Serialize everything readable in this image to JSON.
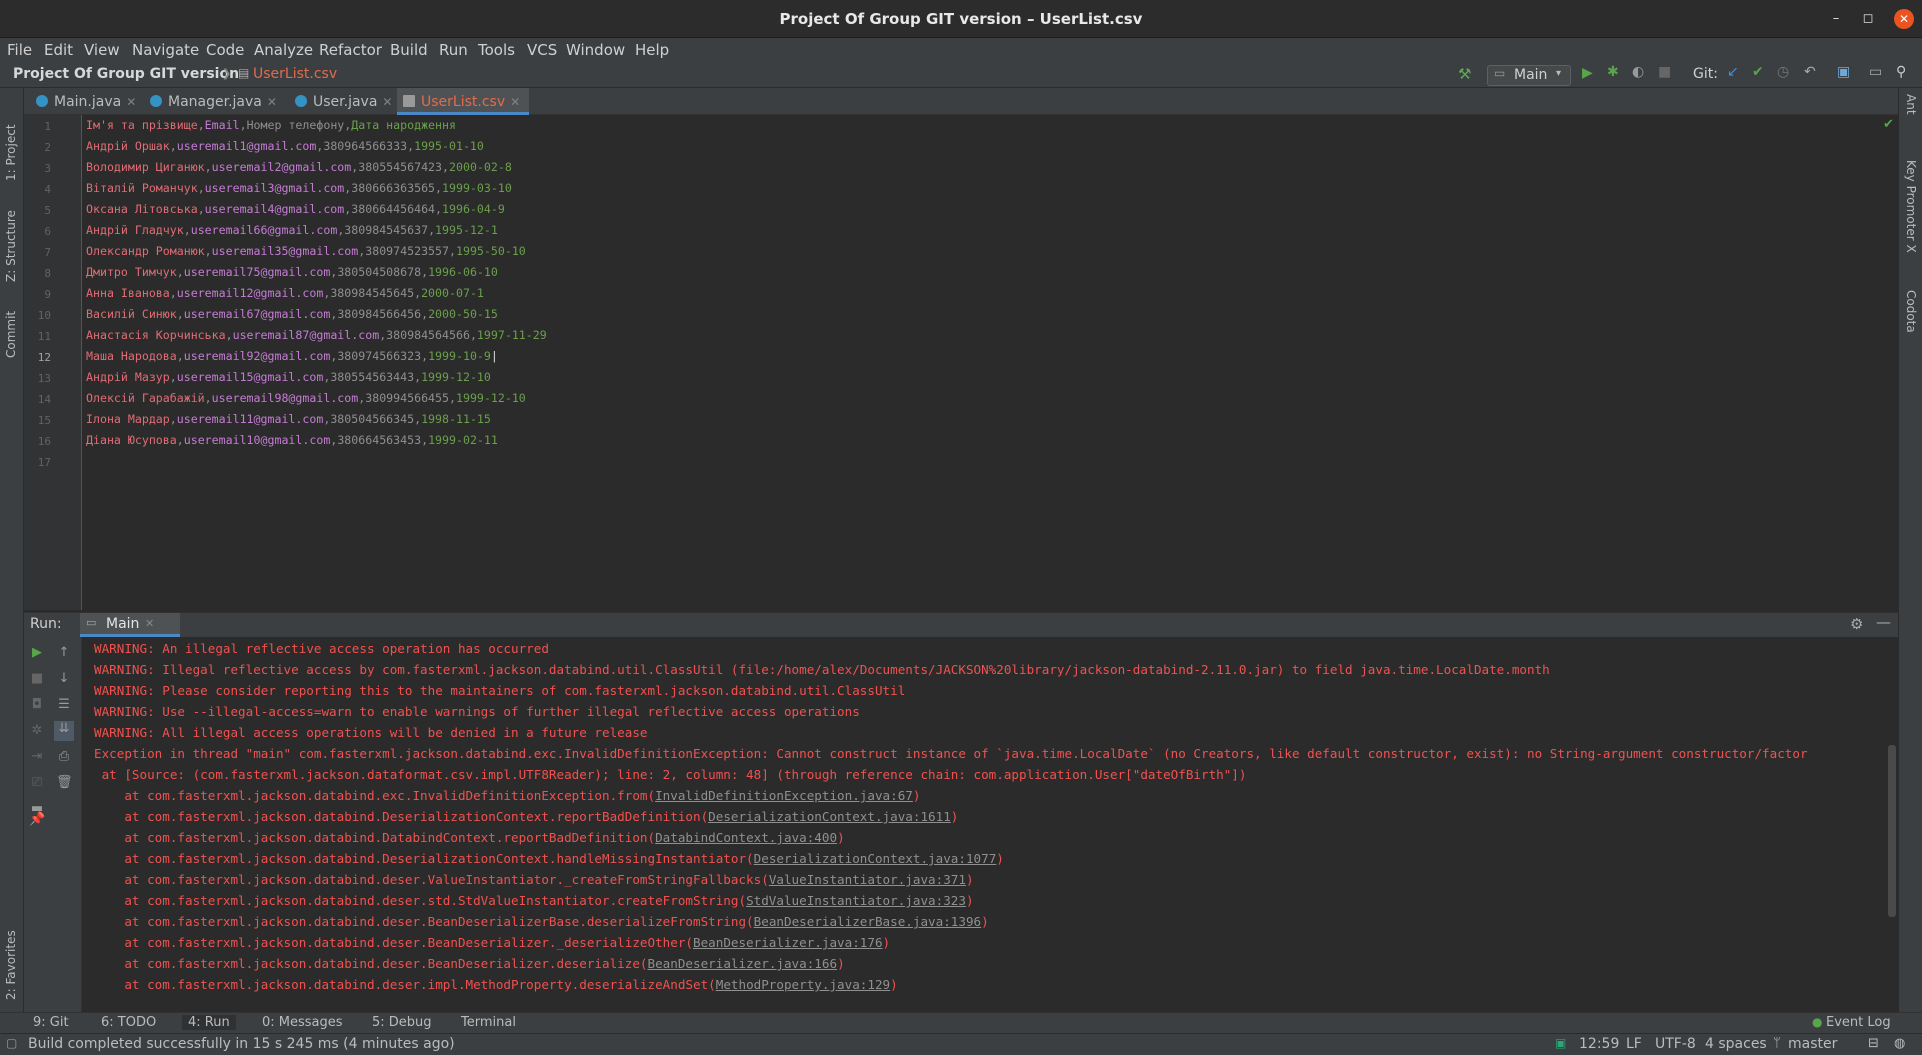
{
  "window": {
    "title": "Project Of Group GIT version – UserList.csv",
    "minimize": "–",
    "maximize": "◻",
    "close": "✕"
  },
  "menu": [
    "File",
    "Edit",
    "View",
    "Navigate",
    "Code",
    "Analyze",
    "Refactor",
    "Build",
    "Run",
    "Tools",
    "VCS",
    "Window",
    "Help"
  ],
  "navbar": {
    "project": "Project Of Group GIT version",
    "file": "UserList.csv",
    "run_config": "Main",
    "git_label": "Git:"
  },
  "left_stripe": [
    "1: Project",
    "Z: Structure",
    "Commit",
    "2: Favorites"
  ],
  "right_stripe": [
    "Ant",
    "Key Promoter X",
    "Codota"
  ],
  "tabs": [
    {
      "label": "Main.java",
      "active": false
    },
    {
      "label": "Manager.java",
      "active": false
    },
    {
      "label": "User.java",
      "active": false
    },
    {
      "label": "UserList.csv",
      "active": true
    }
  ],
  "editor": {
    "line_numbers": [
      "1",
      "2",
      "3",
      "4",
      "5",
      "6",
      "7",
      "8",
      "9",
      "10",
      "11",
      "12",
      "13",
      "14",
      "15",
      "16",
      "17"
    ],
    "lines": [
      [
        "Ім'я та прізвище",
        "Email",
        "Номер телефону",
        "Дата народження"
      ],
      [
        "Андрій Оршак",
        "useremail1@gmail.com",
        "380964566333",
        "1995-01-10"
      ],
      [
        "Володимир Циганюк",
        "useremail2@gmail.com",
        "380554567423",
        "2000-02-8"
      ],
      [
        "Віталій Романчук",
        "useremail3@gmail.com",
        "380666363565",
        "1999-03-10"
      ],
      [
        "Оксана Літовська",
        "useremail4@gmail.com",
        "380664456464",
        "1996-04-9"
      ],
      [
        "Андрій Гладчук",
        "useremail66@gmail.com",
        "380984545637",
        "1995-12-1"
      ],
      [
        "Олександр Романюк",
        "useremail35@gmail.com",
        "380974523557",
        "1995-50-10"
      ],
      [
        "Дмитро Тимчук",
        "useremail75@gmail.com",
        "380504508678",
        "1996-06-10"
      ],
      [
        "Анна Іванова",
        "useremail12@gmail.com",
        "380984545645",
        "2000-07-1"
      ],
      [
        "Василій Синюк",
        "useremail67@gmail.com",
        "380984566456",
        "2000-50-15"
      ],
      [
        "Анастасія Корчинська",
        "useremail87@gmail.com",
        "380984564566",
        "1997-11-29"
      ],
      [
        "Маша Народова",
        "useremail92@gmail.com",
        "380974566323",
        "1999-10-9"
      ],
      [
        "Андрій Мазур",
        "useremail15@gmail.com",
        "380554563443",
        "1999-12-10"
      ],
      [
        "Олексій Гарабажій",
        "useremail98@gmail.com",
        "380994566455",
        "1999-12-10"
      ],
      [
        "Ілона Мардар",
        "useremail11@gmail.com",
        "380504566345",
        "1998-11-15"
      ],
      [
        "Діана Юсупова",
        "useremail10@gmail.com",
        "380664563453",
        "1999-02-11"
      ]
    ]
  },
  "run_panel": {
    "label": "Run:",
    "tab": "Main"
  },
  "console": [
    {
      "text": "WARNING: An illegal reflective access operation has occurred"
    },
    {
      "text": "WARNING: Illegal reflective access by com.fasterxml.jackson.databind.util.ClassUtil (file:/home/alex/Documents/JACKSON%20library/jackson-databind-2.11.0.jar) to field java.time.LocalDate.month"
    },
    {
      "text": "WARNING: Please consider reporting this to the maintainers of com.fasterxml.jackson.databind.util.ClassUtil"
    },
    {
      "text": "WARNING: Use --illegal-access=warn to enable warnings of further illegal reflective access operations"
    },
    {
      "text": "WARNING: All illegal access operations will be denied in a future release"
    },
    {
      "text": "Exception in thread \"main\" com.fasterxml.jackson.databind.exc.InvalidDefinitionException: Cannot construct instance of `java.time.LocalDate` (no Creators, like default constructor, exist): no String-argument constructor/factor"
    },
    {
      "text": " at [Source: (com.fasterxml.jackson.dataformat.csv.impl.UTF8Reader); line: 2, column: 48] (through reference chain: com.application.User[\"dateOfBirth\"])"
    },
    {
      "text": "    at com.fasterxml.jackson.databind.exc.InvalidDefinitionException.from(",
      "link": "InvalidDefinitionException.java:67"
    },
    {
      "text": "    at com.fasterxml.jackson.databind.DeserializationContext.reportBadDefinition(",
      "link": "DeserializationContext.java:1611"
    },
    {
      "text": "    at com.fasterxml.jackson.databind.DatabindContext.reportBadDefinition(",
      "link": "DatabindContext.java:400"
    },
    {
      "text": "    at com.fasterxml.jackson.databind.DeserializationContext.handleMissingInstantiator(",
      "link": "DeserializationContext.java:1077"
    },
    {
      "text": "    at com.fasterxml.jackson.databind.deser.ValueInstantiator._createFromStringFallbacks(",
      "link": "ValueInstantiator.java:371"
    },
    {
      "text": "    at com.fasterxml.jackson.databind.deser.std.StdValueInstantiator.createFromString(",
      "link": "StdValueInstantiator.java:323"
    },
    {
      "text": "    at com.fasterxml.jackson.databind.deser.BeanDeserializerBase.deserializeFromString(",
      "link": "BeanDeserializerBase.java:1396"
    },
    {
      "text": "    at com.fasterxml.jackson.databind.deser.BeanDeserializer._deserializeOther(",
      "link": "BeanDeserializer.java:176"
    },
    {
      "text": "    at com.fasterxml.jackson.databind.deser.BeanDeserializer.deserialize(",
      "link": "BeanDeserializer.java:166"
    },
    {
      "text": "    at com.fasterxml.jackson.databind.deser.impl.MethodProperty.deserializeAndSet(",
      "link": "MethodProperty.java:129"
    }
  ],
  "bottom_tabs": [
    "9: Git",
    "6: TODO",
    "4: Run",
    "0: Messages",
    "5: Debug",
    "Terminal",
    "Event Log"
  ],
  "status": {
    "message": "Build completed successfully in 15 s 245 ms (4 minutes ago)",
    "position": "12:59",
    "line_sep": "LF",
    "encoding": "UTF-8",
    "indent": "4 spaces",
    "branch": "master"
  }
}
